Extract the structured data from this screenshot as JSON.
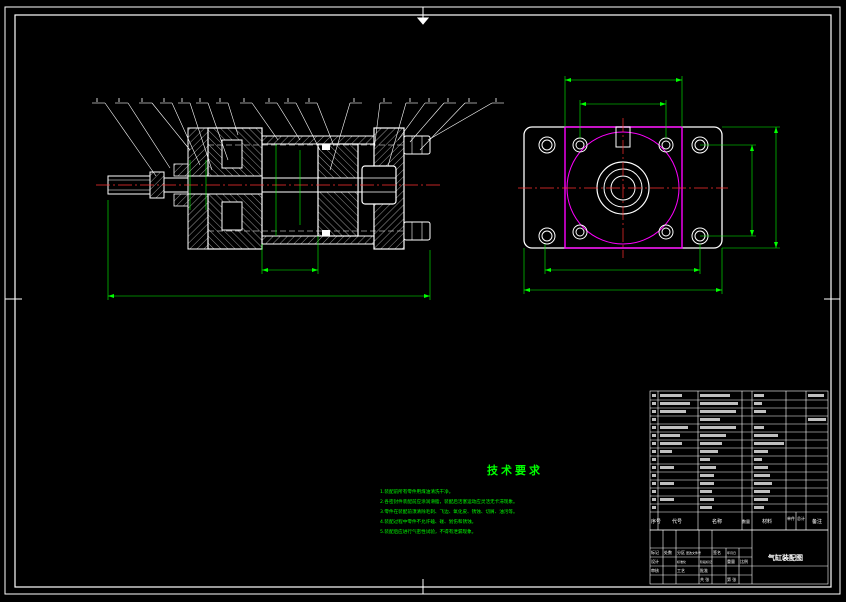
{
  "tech_requirements": {
    "title": "技术要求",
    "items": [
      "1.装配前所有零件用煤油清洗干净。",
      "2.各密封件装配前应涂润滑脂，装配后活塞运动应灵活无卡滞现象。",
      "3.零件在装配前须清除毛刺、飞边、氧化皮、锈蚀、切屑、油污等。",
      "4.装配过程中零件不允许磕、碰、划伤和锈蚀。",
      "5.装配后应进行气密性试验，不得有泄漏现象。"
    ]
  },
  "title_block": {
    "drawing_title": "气缸装配图",
    "header": [
      "序号",
      "代号",
      "名称",
      "数量",
      "材料",
      "单件",
      "总计",
      "备注"
    ],
    "sign_labels": [
      "标记",
      "处数",
      "分区",
      "更改文件号",
      "签名",
      "年月日",
      "设计",
      "标准化",
      "审核",
      "工艺",
      "批准",
      "阶段标记",
      "重量",
      "比例",
      "共 张",
      "第 张"
    ]
  },
  "colors": {
    "background": "#000000",
    "outline": "#ffffff",
    "dimension": "#00ff00",
    "centerline": "#ff3030",
    "hidden": "#ff00ff",
    "leader": "#ffffff",
    "hatch": "#ffffff"
  }
}
